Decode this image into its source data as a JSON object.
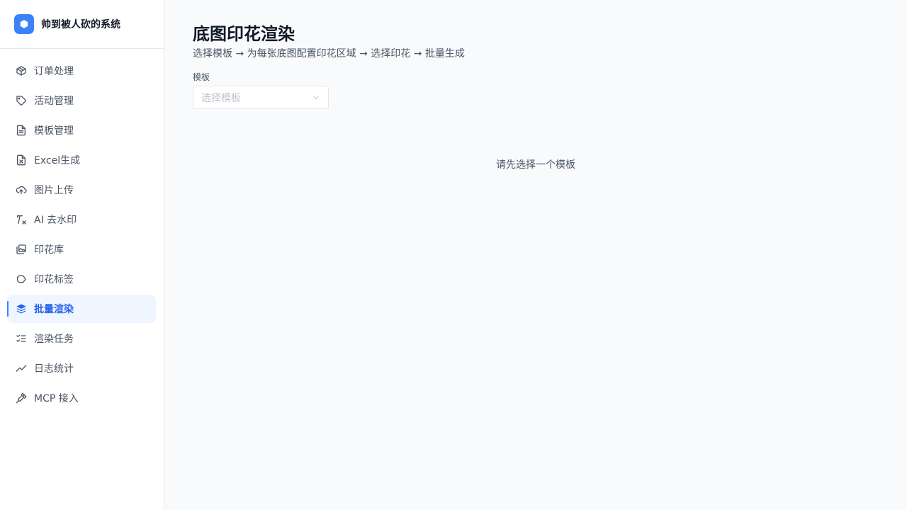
{
  "brand": {
    "title": "帅到被人砍的系统",
    "icon": "cube-icon",
    "accent": "#3b82f6"
  },
  "sidebar": {
    "items": [
      {
        "label": "订单处理",
        "icon": "package-icon"
      },
      {
        "label": "活动管理",
        "icon": "tag-icon"
      },
      {
        "label": "模板管理",
        "icon": "file-text-icon"
      },
      {
        "label": "Excel生成",
        "icon": "file-spreadsheet-icon"
      },
      {
        "label": "图片上传",
        "icon": "cloud-upload-icon"
      },
      {
        "label": "AI 去水印",
        "icon": "remove-formatting-icon"
      },
      {
        "label": "印花库",
        "icon": "image-library-icon"
      },
      {
        "label": "印花标签",
        "icon": "tags-icon"
      },
      {
        "label": "批量渲染",
        "icon": "layers-icon",
        "active": true
      },
      {
        "label": "渲染任务",
        "icon": "list-checks-icon"
      },
      {
        "label": "日志统计",
        "icon": "trending-up-icon"
      },
      {
        "label": "MCP 接入",
        "icon": "plug-icon"
      }
    ]
  },
  "main": {
    "title": "底图印花渲染",
    "subtitle": "选择模板 → 为每张底图配置印花区域 → 选择印花 → 批量生成",
    "template_field": {
      "label": "模板",
      "placeholder": "选择模板"
    },
    "empty_hint": "请先选择一个模板"
  },
  "colors": {
    "active_text": "#2563eb",
    "active_bg": "#eff6ff",
    "border": "#e5e7eb"
  }
}
